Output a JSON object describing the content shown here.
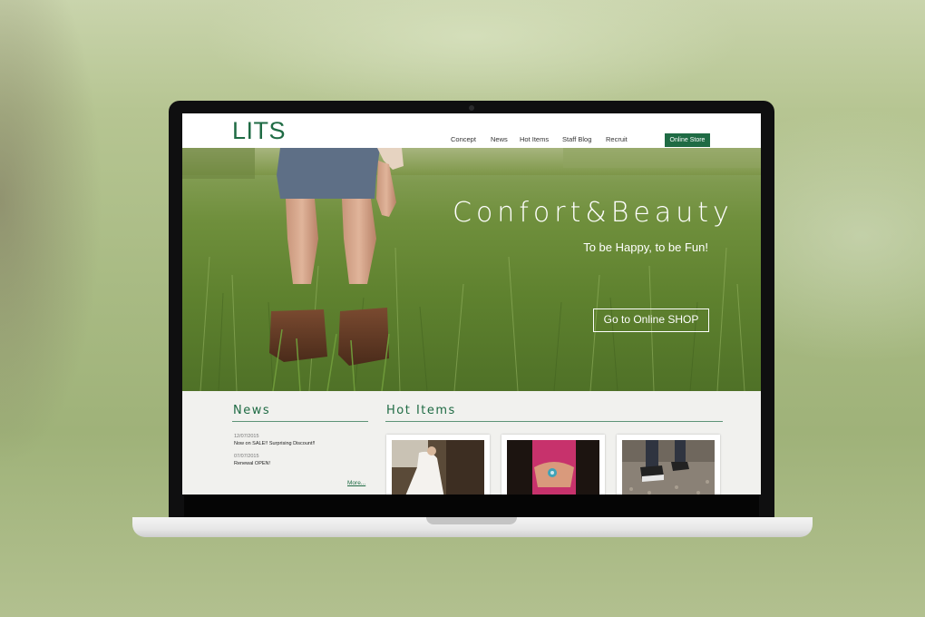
{
  "site": {
    "logo": "LITS",
    "nav": [
      "Concept",
      "News",
      "Hot Items",
      "Staff Blog",
      "Recruit"
    ],
    "store_button": "Online Store"
  },
  "hero": {
    "title": "Confort&Beauty",
    "subtitle": "To be Happy, to be Fun!",
    "cta": "Go to Online SHOP"
  },
  "news": {
    "heading": "News",
    "items": [
      {
        "date": "12/07/2015",
        "text": "Now on SALE!! Surprising Discount!!"
      },
      {
        "date": "07/07/2015",
        "text": "Renewal OPEN!"
      }
    ],
    "more": "More..."
  },
  "hot_items": {
    "heading": "Hot Items",
    "items": [
      {
        "photo": "wedding-dress-photo"
      },
      {
        "photo": "hands-ring-photo"
      },
      {
        "photo": "sneakers-gravel-photo"
      }
    ]
  },
  "colors": {
    "brand_green": "#1f6b44",
    "content_bg": "#f1f1ee"
  }
}
